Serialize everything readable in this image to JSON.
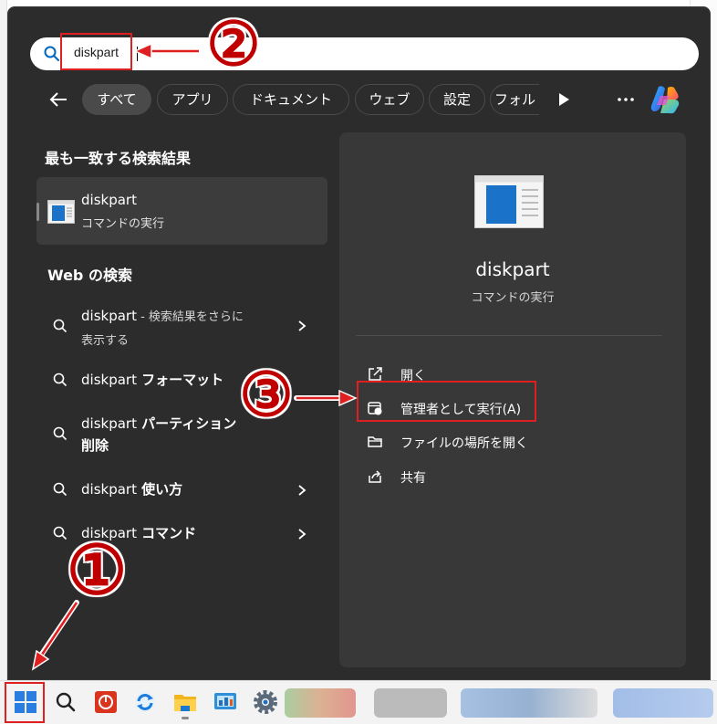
{
  "search": {
    "query": "diskpart"
  },
  "filters": {
    "chips": [
      "すべて",
      "アプリ",
      "ドキュメント",
      "ウェブ",
      "設定",
      "フォル"
    ]
  },
  "best_match": {
    "title": "最も一致する検索結果",
    "name": "diskpart",
    "subtitle": "コマンドの実行"
  },
  "web": {
    "title": "Web の検索",
    "items": [
      {
        "query": "diskpart",
        "suffix": " - 検索結果をさらに",
        "line2": "表示する"
      },
      {
        "query": "diskpart",
        "bold": " フォーマット"
      },
      {
        "query": "diskpart",
        "bold": " パーティション",
        "line2": "削除"
      },
      {
        "query": "diskpart",
        "bold": " 使い方"
      },
      {
        "query": "diskpart",
        "bold": " コマンド"
      }
    ]
  },
  "detail": {
    "name": "diskpart",
    "subtitle": "コマンドの実行",
    "actions": [
      {
        "label": "開く",
        "icon": "open-external-icon"
      },
      {
        "label": "管理者として実行(A)",
        "icon": "admin-shield-icon"
      },
      {
        "label": "ファイルの場所を開く",
        "icon": "folder-icon"
      },
      {
        "label": "共有",
        "icon": "share-icon"
      }
    ]
  },
  "annotations": {
    "one": "①",
    "two": "②",
    "three": "③"
  },
  "colors": {
    "annotation_red": "#e02020",
    "panel_bg": "#2c2c2c",
    "accent_blue": "#0067c0"
  },
  "taskbar": {
    "icons": [
      "start-icon",
      "search-icon",
      "power-app-icon",
      "sync-icon",
      "file-explorer-icon",
      "control-panel-icon",
      "settings-icon"
    ]
  }
}
